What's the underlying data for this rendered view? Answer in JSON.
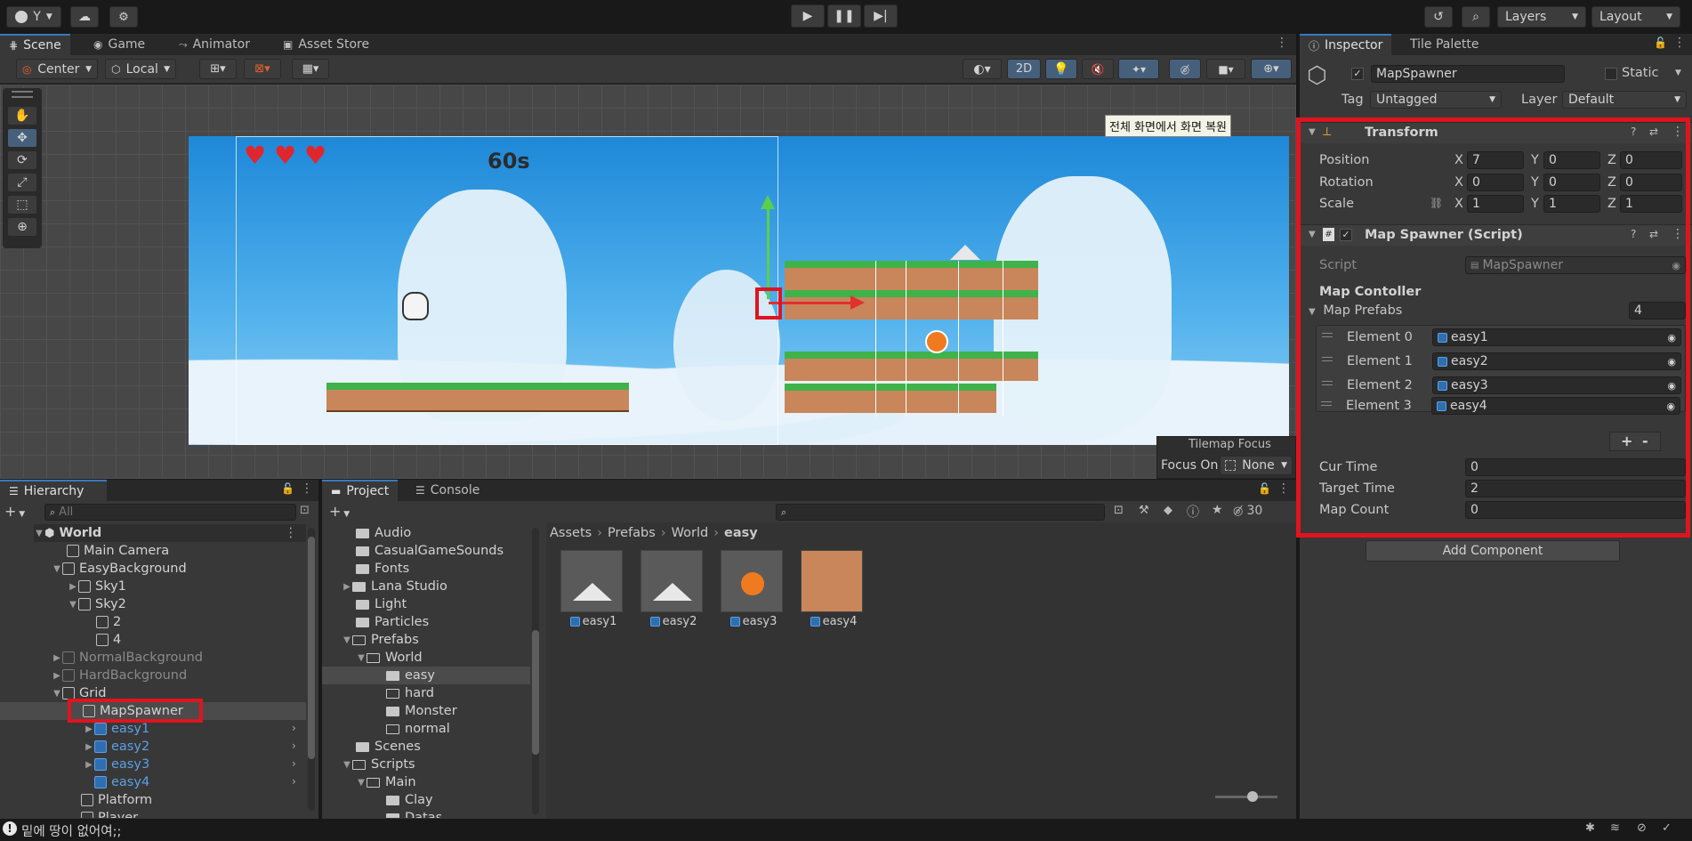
{
  "toolbar": {
    "account_label": "Y",
    "layers_label": "Layers",
    "layout_label": "Layout"
  },
  "scene_tabs": [
    {
      "label": "Scene"
    },
    {
      "label": "Game"
    },
    {
      "label": "Animator"
    },
    {
      "label": "Asset Store"
    }
  ],
  "scene_toolbar": {
    "pivot": "Center",
    "space": "Local",
    "mode_2d": "2D"
  },
  "scene_view": {
    "tooltip": "전체 화면에서 화면 복원",
    "timer": "60s",
    "tilemap_focus": "Tilemap Focus",
    "focus_on_label": "Focus On",
    "focus_on_value": "None"
  },
  "hierarchy": {
    "title": "Hierarchy",
    "search_placeholder": "All",
    "items": [
      {
        "label": "World"
      },
      {
        "label": "Main Camera"
      },
      {
        "label": "EasyBackground"
      },
      {
        "label": "Sky1"
      },
      {
        "label": "Sky2"
      },
      {
        "label": "2"
      },
      {
        "label": "4"
      },
      {
        "label": "NormalBackground"
      },
      {
        "label": "HardBackground"
      },
      {
        "label": "Grid"
      },
      {
        "label": "MapSpawner"
      },
      {
        "label": "easy1"
      },
      {
        "label": "easy2"
      },
      {
        "label": "easy3"
      },
      {
        "label": "easy4"
      },
      {
        "label": "Platform"
      },
      {
        "label": "Player"
      }
    ]
  },
  "project": {
    "tabs": [
      {
        "label": "Project"
      },
      {
        "label": "Console"
      }
    ],
    "count": "30",
    "folders": [
      {
        "label": "Audio"
      },
      {
        "label": "CasualGameSounds"
      },
      {
        "label": "Fonts"
      },
      {
        "label": "Lana Studio"
      },
      {
        "label": "Light"
      },
      {
        "label": "Particles"
      },
      {
        "label": "Prefabs"
      },
      {
        "label": "World"
      },
      {
        "label": "easy"
      },
      {
        "label": "hard"
      },
      {
        "label": "Monster"
      },
      {
        "label": "normal"
      },
      {
        "label": "Scenes"
      },
      {
        "label": "Scripts"
      },
      {
        "label": "Main"
      },
      {
        "label": "Clay"
      },
      {
        "label": "Datas"
      }
    ],
    "breadcrumb": [
      "Assets",
      "Prefabs",
      "World",
      "easy"
    ],
    "assets": [
      {
        "label": "easy1"
      },
      {
        "label": "easy2"
      },
      {
        "label": "easy3"
      },
      {
        "label": "easy4"
      }
    ]
  },
  "inspector": {
    "tabs": [
      {
        "label": "Inspector"
      },
      {
        "label": "Tile Palette"
      }
    ],
    "object_name": "MapSpawner",
    "static_label": "Static",
    "tag_label": "Tag",
    "tag_value": "Untagged",
    "layer_label": "Layer",
    "layer_value": "Default",
    "transform": {
      "title": "Transform",
      "position_label": "Position",
      "rotation_label": "Rotation",
      "scale_label": "Scale",
      "position": {
        "x": "7",
        "y": "0",
        "z": "0"
      },
      "rotation": {
        "x": "0",
        "y": "0",
        "z": "0"
      },
      "scale": {
        "x": "1",
        "y": "1",
        "z": "1"
      },
      "axis_x": "X",
      "axis_y": "Y",
      "axis_z": "Z"
    },
    "script_comp": {
      "title": "Map Spawner (Script)",
      "script_label": "Script",
      "script_value": "MapSpawner",
      "section_label": "Map Contoller",
      "prefabs_label": "Map Prefabs",
      "prefabs_count": "4",
      "elements": [
        {
          "label": "Element 0",
          "value": "easy1"
        },
        {
          "label": "Element 1",
          "value": "easy2"
        },
        {
          "label": "Element 2",
          "value": "easy3"
        },
        {
          "label": "Element 3",
          "value": "easy4"
        }
      ],
      "cur_time_label": "Cur Time",
      "cur_time": "0",
      "target_time_label": "Target Time",
      "target_time": "2",
      "map_count_label": "Map Count",
      "map_count": "0"
    },
    "add_component": "Add Component"
  },
  "status_bar": {
    "message": "밑에 땅이 없어여;;"
  }
}
